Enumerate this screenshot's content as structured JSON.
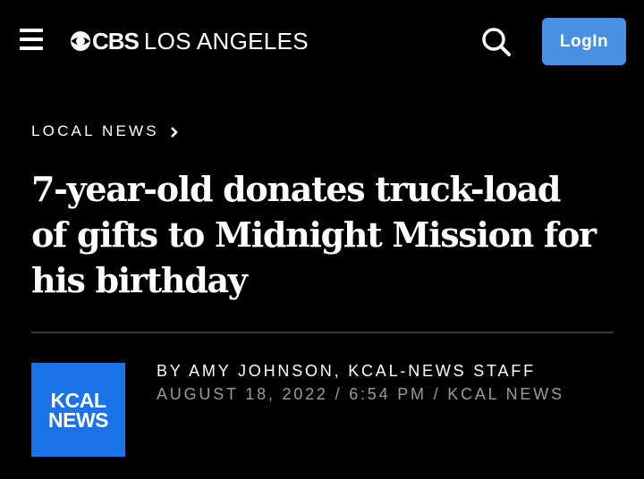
{
  "header": {
    "menu_icon": "hamburger-menu-icon",
    "logo_brand": "CBS",
    "logo_city": "LOS ANGELES",
    "search_icon": "search-icon",
    "login_label": "LogIn",
    "login_color": "#4a90e2"
  },
  "article": {
    "section": "LOCAL NEWS",
    "headline": "7-year-old donates truck-load of gifts to Midnight Mission for his birthday",
    "byline_prefix": "BY",
    "author": "AMY JOHNSON, KCAL-NEWS STAFF",
    "date": "AUGUST 18, 2022",
    "time": "6:54 PM",
    "source": "KCAL NEWS",
    "separator": "/",
    "author_logo_line1": "KCAL",
    "author_logo_line2": "NEWS",
    "author_logo_color": "#1a73e8"
  }
}
